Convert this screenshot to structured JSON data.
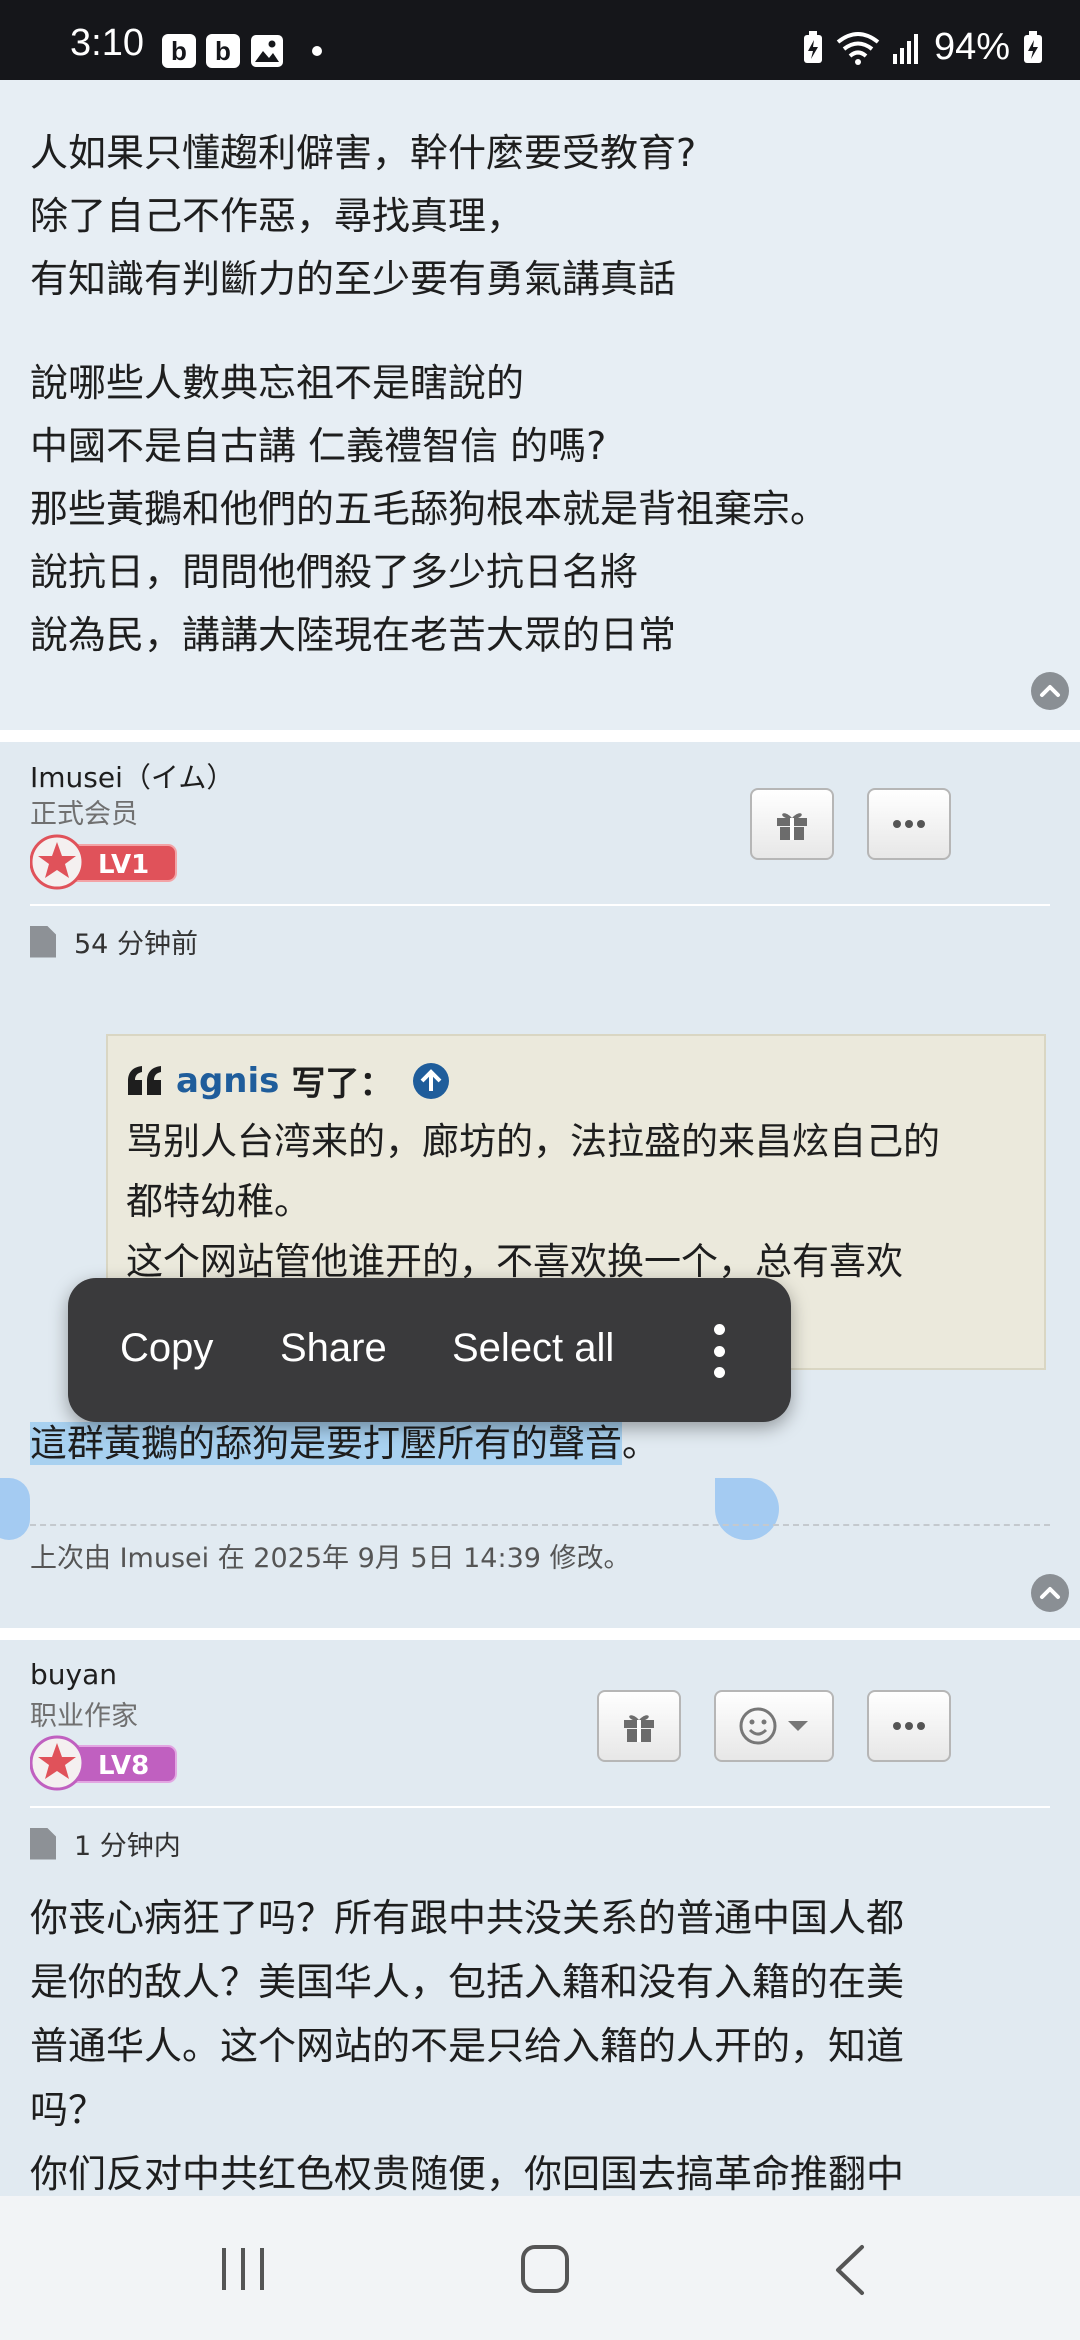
{
  "status_bar": {
    "time": "3:10",
    "notif_badges": [
      "b",
      "b"
    ],
    "battery": "94%"
  },
  "post1": {
    "paragraph1": [
      "人如果只懂趨利僻害，幹什麼要受教育?",
      "除了自己不作惡，尋找真理，",
      "有知識有判斷力的至少要有勇氣講真話"
    ],
    "paragraph2": [
      "說哪些人數典忘祖不是瞎說的",
      "中國不是自古講 仁義禮智信 的嗎?",
      "那些黃鵝和他們的五毛舔狗根本就是背祖棄宗。",
      "說抗日，問問他們殺了多少抗日名將",
      "說為民，講講大陸現在老苦大眾的日常"
    ]
  },
  "post2": {
    "author": "Imusei（イム）",
    "rank": "正式会员",
    "level": "LV1",
    "time": "54 分钟前",
    "quote": {
      "author": "agnis",
      "wrote": "写了：",
      "lines": [
        "骂别人台湾来的，廊坊的，法拉盛的来昌炫自己的",
        "都特幼稚。",
        "这个网站管他谁开的，不喜欢换一个，总有喜欢"
      ]
    },
    "selected_text": "這群黃鵝的舔狗是要打壓所有的聲音",
    "trailing_text": "。",
    "edited_note": "上次由 Imusei 在 2025年 9月 5日 14:39 修改。"
  },
  "context_menu": {
    "copy": "Copy",
    "share": "Share",
    "select_all": "Select all"
  },
  "post3": {
    "author": "buyan",
    "rank": "职业作家",
    "level": "LV8",
    "time": "1 分钟内",
    "lines": [
      "你丧心病狂了吗？所有跟中共没关系的普通中国人都",
      "是你的敌人？美国华人，包括入籍和没有入籍的在美",
      "普通华人。这个网站的不是只给入籍的人开的，知道",
      "吗？",
      "你们反对中共红色权贵随便，你回国去搞革命推翻中"
    ]
  },
  "colors": {
    "accent_blue": "#1f5d9b",
    "selection": "#a8d1f0",
    "badge_red": "#e0525a",
    "badge_purple": "#c060c0"
  }
}
